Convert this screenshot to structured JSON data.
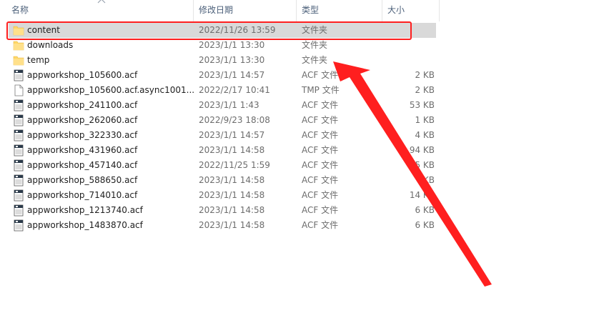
{
  "header": {
    "name_label": "名称",
    "date_label": "修改日期",
    "type_label": "类型",
    "size_label": "大小"
  },
  "files": [
    {
      "name": "content",
      "date": "2022/11/26 13:59",
      "type": "文件夹",
      "size": "",
      "icon": "folder-icon",
      "selected": true
    },
    {
      "name": "downloads",
      "date": "2023/1/1 13:30",
      "type": "文件夹",
      "size": "",
      "icon": "folder-icon"
    },
    {
      "name": "temp",
      "date": "2023/1/1 13:30",
      "type": "文件夹",
      "size": "",
      "icon": "folder-icon"
    },
    {
      "name": "appworkshop_105600.acf",
      "date": "2023/1/1 14:57",
      "type": "ACF 文件",
      "size": "2 KB",
      "icon": "acf-file-icon"
    },
    {
      "name": "appworkshop_105600.acf.async1001...",
      "date": "2022/2/17 10:41",
      "type": "TMP 文件",
      "size": "2 KB",
      "icon": "blank-file-icon"
    },
    {
      "name": "appworkshop_241100.acf",
      "date": "2023/1/1 1:43",
      "type": "ACF 文件",
      "size": "53 KB",
      "icon": "acf-file-icon"
    },
    {
      "name": "appworkshop_262060.acf",
      "date": "2022/9/23 18:08",
      "type": "ACF 文件",
      "size": "1 KB",
      "icon": "acf-file-icon"
    },
    {
      "name": "appworkshop_322330.acf",
      "date": "2023/1/1 14:57",
      "type": "ACF 文件",
      "size": "4 KB",
      "icon": "acf-file-icon"
    },
    {
      "name": "appworkshop_431960.acf",
      "date": "2023/1/1 14:58",
      "type": "ACF 文件",
      "size": "94 KB",
      "icon": "acf-file-icon"
    },
    {
      "name": "appworkshop_457140.acf",
      "date": "2022/11/25 1:59",
      "type": "ACF 文件",
      "size": "5 KB",
      "icon": "acf-file-icon"
    },
    {
      "name": "appworkshop_588650.acf",
      "date": "2023/1/1 14:58",
      "type": "ACF 文件",
      "size": "KB",
      "icon": "acf-file-icon"
    },
    {
      "name": "appworkshop_714010.acf",
      "date": "2023/1/1 14:58",
      "type": "ACF 文件",
      "size": "14 KB",
      "icon": "acf-file-icon"
    },
    {
      "name": "appworkshop_1213740.acf",
      "date": "2023/1/1 14:58",
      "type": "ACF 文件",
      "size": "6 KB",
      "icon": "acf-file-icon"
    },
    {
      "name": "appworkshop_1483870.acf",
      "date": "2023/1/1 14:58",
      "type": "ACF 文件",
      "size": "6 KB",
      "icon": "acf-file-icon"
    }
  ],
  "colors": {
    "highlight": "#ff1f1f",
    "selection": "#d9d9d9",
    "folder": "#ffd766",
    "header_text": "#4c607a"
  }
}
